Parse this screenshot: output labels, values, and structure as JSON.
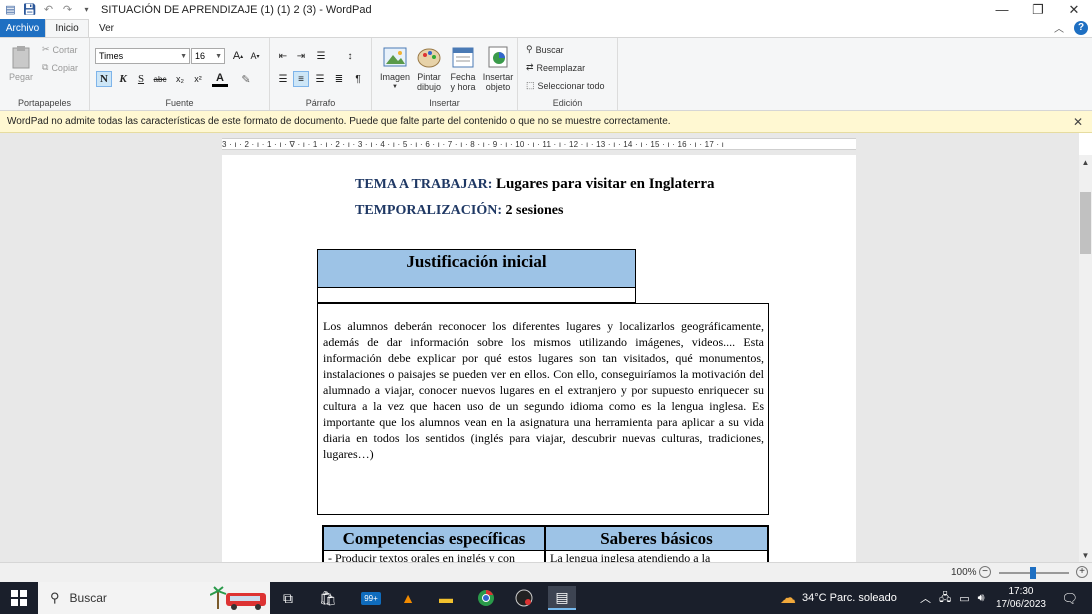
{
  "window": {
    "title": "SITUACIÓN DE APRENDIZAJE (1) (1) 2 (3) - WordPad",
    "controls": {
      "minimize": "—",
      "restore": "❐",
      "close": "✕"
    }
  },
  "tabs": {
    "file": "Archivo",
    "home": "Inicio",
    "view": "Ver"
  },
  "ribbon": {
    "clipboard": {
      "label": "Portapapeles",
      "paste": "Pegar",
      "cut": "Cortar",
      "copy": "Copiar"
    },
    "font": {
      "label": "Fuente",
      "family": "Times",
      "size": "16",
      "bold": "N",
      "italic": "K",
      "underline": "S",
      "strike": "abc",
      "sub": "x₂",
      "sup": "x²",
      "color": "A"
    },
    "paragraph": {
      "label": "Párrafo"
    },
    "insert": {
      "label": "Insertar",
      "image": "Imagen",
      "paint_1": "Pintar",
      "paint_2": "dibujo",
      "date_1": "Fecha",
      "date_2": "y hora",
      "object_1": "Insertar",
      "object_2": "objeto"
    },
    "edit": {
      "label": "Edición",
      "find": "Buscar",
      "replace": "Reemplazar",
      "select_all": "Seleccionar todo"
    }
  },
  "infobar": {
    "text": "WordPad no admite todas las características de este formato de documento. Puede que falte parte del contenido o que no se muestre correctamente."
  },
  "ruler": {
    "text": "3 · ı · 2 · ı · 1 · ı · ∇ · ı · 1 · ı · 2 · ı · 3 · ı · 4 · ı · 5 · ı · 6 · ı · 7 · ı · 8 · ı · 9 · ı · 10 · ı · 11 · ı · 12 · ı · 13 · ı · 14 · ı · 15 · ı · 16 · ı · 17 · ı"
  },
  "document": {
    "tema_label": "TEMA A TRABAJAR:",
    "tema_value": "Lugares para visitar en Inglaterra",
    "tempo_label": "TEMPORALIZACIÓN:",
    "tempo_value": "2 sesiones",
    "justificacion_title": "Justificación inicial",
    "justificacion_text": "Los alumnos deberán reconocer los diferentes lugares y localizarlos geográficamente, además de dar información sobre los mismos utilizando imágenes, videos.... Esta información debe explicar por qué estos lugares son tan visitados, qué monumentos, instalaciones o paisajes se pueden ver en ellos. Con ello, conseguiríamos la motivación del alumnado a viajar, conocer nuevos lugares en el extranjero y por supuesto enriquecer su cultura a la vez que hacen uso de un segundo idioma como es la lengua inglesa. Es importante que los alumnos vean en la asignatura una herramienta para aplicar a su vida diaria en todos los sentidos (inglés para viajar, descubrir nuevas culturas, tradiciones, lugares…)",
    "col1_header": "Competencias específicas",
    "col2_header": "Saberes básicos",
    "col1_row1": "- Producir textos orales en inglés y con",
    "col2_row1": "La lengua inglesa atendiendo a la"
  },
  "status": {
    "zoom": "100%"
  },
  "taskbar": {
    "search_placeholder": "Buscar",
    "weather": "34°C Parc. soleado",
    "time": "17:30",
    "date": "17/06/2023",
    "badge": "99+"
  }
}
